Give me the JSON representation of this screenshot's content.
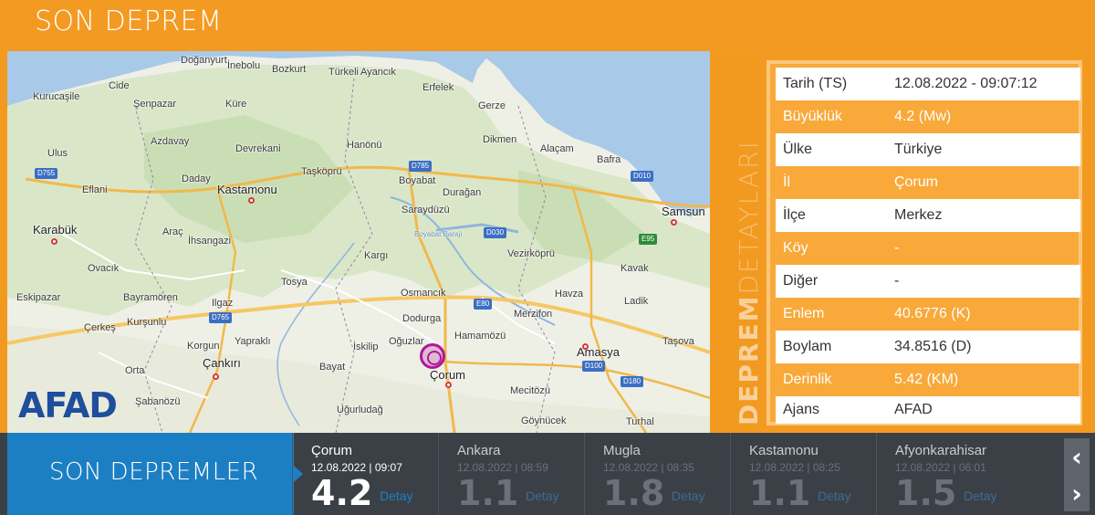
{
  "header": {
    "title": "SON DEPREM"
  },
  "map": {
    "logo": "AFAD",
    "labels": [
      {
        "t": "Doğanyurt"
      },
      {
        "t": "İnebolu"
      },
      {
        "t": "Bozkurt"
      },
      {
        "t": "Türkeli"
      },
      {
        "t": "Ayancık"
      },
      {
        "t": "Kurucaşile"
      },
      {
        "t": "Cide"
      },
      {
        "t": "Erfelek"
      },
      {
        "t": "Şenpazar"
      },
      {
        "t": "Küre"
      },
      {
        "t": "Gerze"
      },
      {
        "t": "Azdavay"
      },
      {
        "t": "Devrekani"
      },
      {
        "t": "Hanönü"
      },
      {
        "t": "Dikmen"
      },
      {
        "t": "Alaçam"
      },
      {
        "t": "Ulus"
      },
      {
        "t": "Taşköprü"
      },
      {
        "t": "Bafra"
      },
      {
        "t": "Daday"
      },
      {
        "t": "Boyabat"
      },
      {
        "t": "Eflani"
      },
      {
        "t": "Kastamonu"
      },
      {
        "t": "Durağan"
      },
      {
        "t": "Saraydüzü"
      },
      {
        "t": "Samsun"
      },
      {
        "t": "Karabük"
      },
      {
        "t": "Araç"
      },
      {
        "t": "İhsangazi"
      },
      {
        "t": "Vezirköprü"
      },
      {
        "t": "Kargı"
      },
      {
        "t": "Ovacık"
      },
      {
        "t": "Kavak"
      },
      {
        "t": "Tosya"
      },
      {
        "t": "Eskipazar"
      },
      {
        "t": "Bayramören"
      },
      {
        "t": "Osmancık"
      },
      {
        "t": "Havza"
      },
      {
        "t": "Ilgaz"
      },
      {
        "t": "Ladik"
      },
      {
        "t": "Çerkeş"
      },
      {
        "t": "Kurşunlu"
      },
      {
        "t": "Dodurga"
      },
      {
        "t": "Merzifon"
      },
      {
        "t": "Hamamözü"
      },
      {
        "t": "Korgun"
      },
      {
        "t": "Yapraklı"
      },
      {
        "t": "İskilip"
      },
      {
        "t": "Oğuzlar"
      },
      {
        "t": "Amasya"
      },
      {
        "t": "Taşova"
      },
      {
        "t": "Orta"
      },
      {
        "t": "Çankırı"
      },
      {
        "t": "Bayat"
      },
      {
        "t": "Çorum"
      },
      {
        "t": "Şabanözü"
      },
      {
        "t": "Mecitözü"
      },
      {
        "t": "Uğurludağ"
      },
      {
        "t": "Göynücek"
      },
      {
        "t": "Turhal"
      },
      {
        "t": "Boyabat Barajı"
      }
    ],
    "roads": [
      "D755",
      "D785",
      "D010",
      "E95",
      "D030",
      "E80",
      "D765",
      "D100",
      "D180"
    ]
  },
  "side_title": {
    "bold": "DEPREM",
    "light": "DETAYLARI"
  },
  "details": [
    {
      "k": "Tarih (TS)",
      "v": "12.08.2022 - 09:07:12"
    },
    {
      "k": "Büyüklük",
      "v": "4.2 (Mw)"
    },
    {
      "k": "Ülke",
      "v": "Türkiye"
    },
    {
      "k": "İl",
      "v": "Çorum"
    },
    {
      "k": "İlçe",
      "v": "Merkez"
    },
    {
      "k": "Köy",
      "v": "-"
    },
    {
      "k": "Diğer",
      "v": "-"
    },
    {
      "k": "Enlem",
      "v": "40.6776 (K)"
    },
    {
      "k": "Boylam",
      "v": "34.8516 (D)"
    },
    {
      "k": "Derinlik",
      "v": "5.42 (KM)"
    },
    {
      "k": "Ajans",
      "v": "AFAD"
    }
  ],
  "recent": {
    "label": "SON DEPREMLER",
    "detail_label": "Detay",
    "items": [
      {
        "city": "Çorum",
        "when": "12.08.2022 | 09:07",
        "mag": "4.2"
      },
      {
        "city": "Ankara",
        "when": "12.08.2022 | 08:59",
        "mag": "1.1"
      },
      {
        "city": "Mugla",
        "when": "12.08.2022 | 08:35",
        "mag": "1.8"
      },
      {
        "city": "Kastamonu",
        "when": "12.08.2022 | 08:25",
        "mag": "1.1"
      },
      {
        "city": "Afyonkarahisar",
        "when": "12.08.2022 | 06:01",
        "mag": "1.5"
      }
    ],
    "prev_icon": "chevron-left-icon",
    "next_icon": "chevron-right-icon"
  }
}
